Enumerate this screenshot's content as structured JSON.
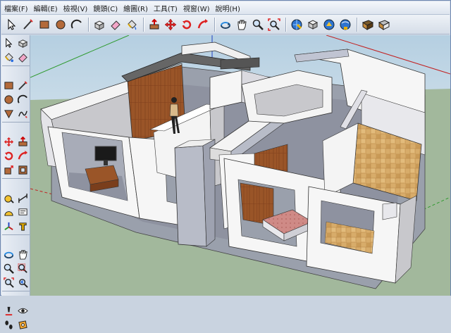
{
  "menubar": {
    "items": [
      {
        "label": "檔案(F)"
      },
      {
        "label": "編輯(E)"
      },
      {
        "label": "檢視(V)"
      },
      {
        "label": "鏡頭(C)"
      },
      {
        "label": "繪圖(R)"
      },
      {
        "label": "工具(T)"
      },
      {
        "label": "視窗(W)"
      },
      {
        "label": "說明(H)"
      }
    ]
  },
  "toolbar": {
    "tools": [
      "select-icon",
      "line-icon",
      "rectangle-icon",
      "circle-icon",
      "arc-icon",
      "make-component-icon",
      "eraser-icon",
      "paint-bucket-icon",
      "push-pull-icon",
      "move-icon",
      "rotate-icon",
      "follow-me-icon",
      "orbit-icon",
      "pan-icon",
      "zoom-icon",
      "zoom-extents-icon",
      "get-models-icon",
      "share-model-icon",
      "share-component-icon",
      "warehouse-icon",
      "photo-icon",
      "photo-texture-icon"
    ]
  },
  "sidebar": {
    "tools": [
      "select-icon",
      "make-component-icon",
      "paint-bucket-icon",
      "eraser-icon",
      "rectangle-icon",
      "line-icon",
      "circle-icon",
      "arc-icon",
      "polygon-icon",
      "freehand-icon",
      "move-icon",
      "push-pull-icon",
      "rotate-icon",
      "follow-me-icon",
      "scale-icon",
      "offset-icon",
      "tape-measure-icon",
      "dimension-icon",
      "protractor-icon",
      "text-icon",
      "axes-icon",
      "3d-text-icon",
      "orbit-icon",
      "pan-icon",
      "zoom-icon",
      "zoom-window-icon",
      "zoom-extents-icon",
      "previous-view-icon",
      "position-camera-icon",
      "look-around-icon",
      "walk-icon",
      "section-plane-icon"
    ]
  },
  "colors": {
    "sky": "#c3d8e6",
    "ground": "#a2b89c",
    "wall": "#ffffff",
    "wall_shade": "#c8c8cc",
    "wood": "#8d4a22",
    "tile": "#d8ac6a",
    "bed": "#cf8a86",
    "axis_green": "#2e9a2e",
    "axis_red": "#c22020",
    "axis_blue": "#2040c0"
  }
}
